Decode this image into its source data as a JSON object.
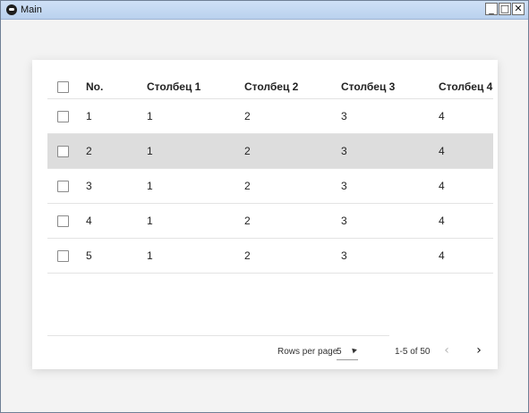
{
  "window": {
    "title": "Main",
    "controls": {
      "minimize": "_",
      "maximize": "□",
      "close": "✕"
    }
  },
  "table": {
    "headers": [
      "No.",
      "Столбец 1",
      "Столбец 2",
      "Столбец 3",
      "Столбец 4"
    ],
    "rows": [
      [
        "1",
        "1",
        "2",
        "3",
        "4"
      ],
      [
        "2",
        "1",
        "2",
        "3",
        "4"
      ],
      [
        "3",
        "1",
        "2",
        "3",
        "4"
      ],
      [
        "4",
        "1",
        "2",
        "3",
        "4"
      ],
      [
        "5",
        "1",
        "2",
        "3",
        "4"
      ]
    ],
    "highlighted_row": 2
  },
  "pagination": {
    "rows_per_page_label": "Rows per page",
    "rows_per_page_value": "5",
    "range_text": "1-5 of 50",
    "prev_icon": "‹",
    "next_icon": "›"
  },
  "colors": {
    "highlight_row": "#dddddd",
    "titlebar": "#b9d1ee"
  }
}
